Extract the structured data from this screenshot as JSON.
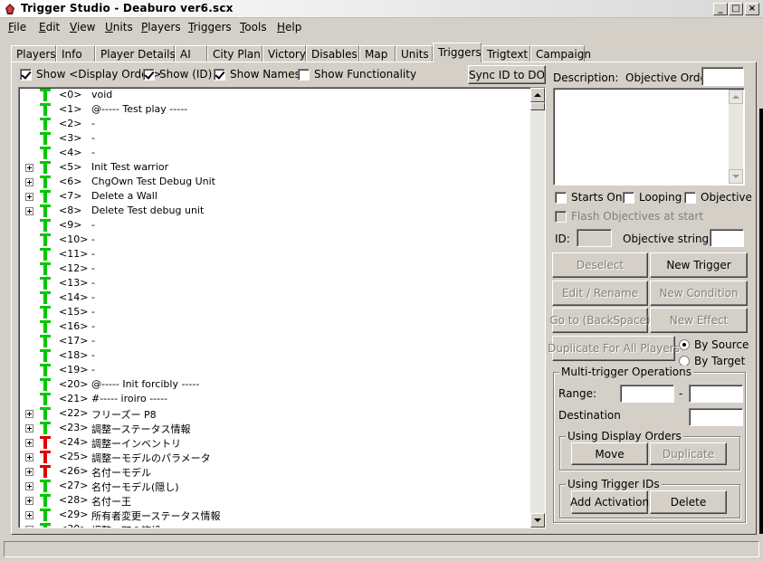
{
  "window": {
    "title": "Trigger Studio - Deaburo ver6.scx",
    "minimize": "_",
    "maximize": "□",
    "close": "×"
  },
  "menu": [
    "File",
    "Edit",
    "View",
    "Units",
    "Players",
    "Triggers",
    "Tools",
    "Help"
  ],
  "menu_mnemonics": [
    "F",
    "E",
    "V",
    "U",
    "P",
    "T",
    "T",
    "H"
  ],
  "tabs": [
    "Players",
    "Info",
    "Player Details",
    "AI",
    "City Plan",
    "Victory",
    "Disables",
    "Map",
    "Units",
    "Triggers",
    "Trigtext",
    "Campaign"
  ],
  "active_tab": "Triggers",
  "list_options": {
    "show_display_order": {
      "label": "Show <Display Order>",
      "checked": true
    },
    "show_id": {
      "label": "Show (ID)",
      "checked": true
    },
    "show_names": {
      "label": "Show Names",
      "checked": true
    },
    "show_functionality": {
      "label": "Show Functionality",
      "checked": false
    },
    "sync_button": "Sync ID to DO"
  },
  "triggers": [
    {
      "id": "<0>",
      "name": "void",
      "icon": "green",
      "expandable": false
    },
    {
      "id": "<1>",
      "name": "@----- Test play -----",
      "icon": "green",
      "expandable": false
    },
    {
      "id": "<2>",
      "name": "-",
      "icon": "green",
      "expandable": false
    },
    {
      "id": "<3>",
      "name": "-",
      "icon": "green",
      "expandable": false
    },
    {
      "id": "<4>",
      "name": "-",
      "icon": "green",
      "expandable": false
    },
    {
      "id": "<5>",
      "name": "Init Test warrior",
      "icon": "green",
      "expandable": true
    },
    {
      "id": "<6>",
      "name": "ChgOwn Test Debug Unit",
      "icon": "green",
      "expandable": true
    },
    {
      "id": "<7>",
      "name": "Delete a Wall",
      "icon": "green",
      "expandable": true
    },
    {
      "id": "<8>",
      "name": "Delete Test debug unit",
      "icon": "green",
      "expandable": true
    },
    {
      "id": "<9>",
      "name": "-",
      "icon": "green",
      "expandable": false
    },
    {
      "id": "<10>",
      "name": "-",
      "icon": "green",
      "expandable": false
    },
    {
      "id": "<11>",
      "name": "-",
      "icon": "green",
      "expandable": false
    },
    {
      "id": "<12>",
      "name": "-",
      "icon": "green",
      "expandable": false
    },
    {
      "id": "<13>",
      "name": "-",
      "icon": "green",
      "expandable": false
    },
    {
      "id": "<14>",
      "name": "-",
      "icon": "green",
      "expandable": false
    },
    {
      "id": "<15>",
      "name": "-",
      "icon": "green",
      "expandable": false
    },
    {
      "id": "<16>",
      "name": "-",
      "icon": "green",
      "expandable": false
    },
    {
      "id": "<17>",
      "name": "-",
      "icon": "green",
      "expandable": false
    },
    {
      "id": "<18>",
      "name": "-",
      "icon": "green",
      "expandable": false
    },
    {
      "id": "<19>",
      "name": "-",
      "icon": "green",
      "expandable": false
    },
    {
      "id": "<20>",
      "name": "@----- Init forcibly -----",
      "icon": "green",
      "expandable": false
    },
    {
      "id": "<21>",
      "name": "#----- iroiro -----",
      "icon": "green",
      "expandable": false
    },
    {
      "id": "<22>",
      "name": "フリーズー P8",
      "icon": "green",
      "expandable": true
    },
    {
      "id": "<23>",
      "name": "調整ーステータス情報",
      "icon": "green",
      "expandable": true
    },
    {
      "id": "<24>",
      "name": "調整ーインベントリ",
      "icon": "red",
      "expandable": true
    },
    {
      "id": "<25>",
      "name": "調整ーモデルのパラメータ",
      "icon": "red",
      "expandable": true
    },
    {
      "id": "<26>",
      "name": "名付ーモデル",
      "icon": "red",
      "expandable": true
    },
    {
      "id": "<27>",
      "name": "名付ーモデル(隠し)",
      "icon": "green",
      "expandable": true
    },
    {
      "id": "<28>",
      "name": "名付ー王",
      "icon": "green",
      "expandable": true
    },
    {
      "id": "<29>",
      "name": "所有者変更ーステータス情報",
      "icon": "green",
      "expandable": true
    },
    {
      "id": "<30>",
      "name": "調整ー町の施設",
      "icon": "green",
      "expandable": true
    }
  ],
  "colors": {
    "trigger_green": "#00c800",
    "trigger_red": "#e00000"
  },
  "right_panel": {
    "description_label": "Description:",
    "objective_order_label": "Objective Order",
    "objective_order_value": "",
    "starts_on": {
      "label": "Starts On",
      "checked": false
    },
    "looping": {
      "label": "Looping",
      "checked": false
    },
    "objective": {
      "label": "Objective",
      "checked": false
    },
    "flash_objectives": {
      "label": "Flash Objectives at start",
      "checked": false
    },
    "id_label": "ID:",
    "objective_string_id_label": "Objective string ID:",
    "buttons": {
      "deselect": "Deselect",
      "new_trigger": "New Trigger",
      "edit_rename": "Edit / Rename",
      "new_condition": "New Condition",
      "goto": "Go to (BackSpace)",
      "new_effect": "New Effect",
      "duplicate_all": "Duplicate For All Players"
    },
    "by_source": {
      "label": "By Source",
      "selected": true
    },
    "by_target": {
      "label": "By Target",
      "selected": false
    },
    "multi": {
      "title": "Multi-trigger Operations",
      "range_label": "Range:",
      "range_sep": "-",
      "destination_label": "Destination",
      "display_orders": {
        "title": "Using Display Orders",
        "move": "Move",
        "duplicate": "Duplicate"
      },
      "trigger_ids": {
        "title": "Using Trigger IDs",
        "add_activation": "Add Activation",
        "delete": "Delete"
      }
    }
  }
}
